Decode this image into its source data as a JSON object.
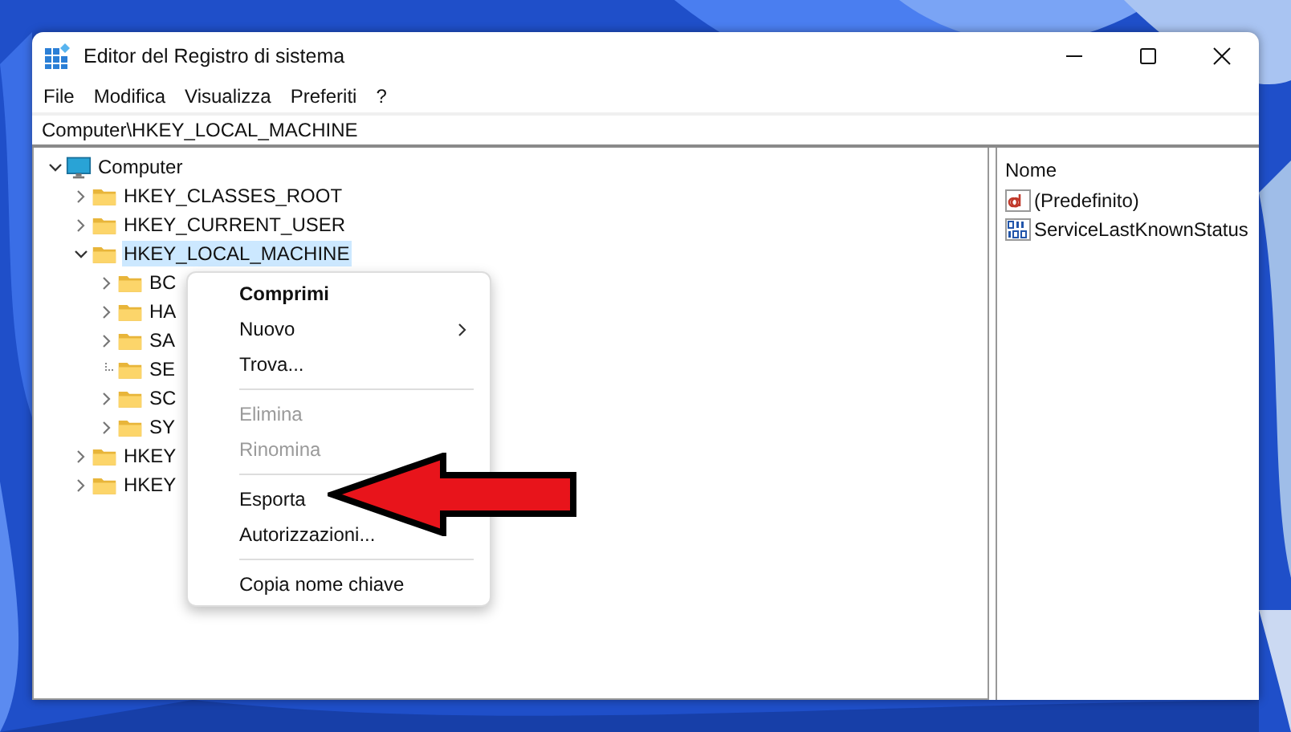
{
  "window": {
    "title": "Editor del Registro di sistema"
  },
  "menu_bar": [
    "File",
    "Modifica",
    "Visualizza",
    "Preferiti",
    "?"
  ],
  "address_bar": {
    "value": "Computer\\HKEY_LOCAL_MACHINE"
  },
  "tree": [
    {
      "label": "Computer",
      "kind": "computer",
      "expandable": true,
      "expanded": true,
      "selected": false,
      "children": [
        {
          "label": "HKEY_CLASSES_ROOT",
          "kind": "folder",
          "expandable": true,
          "expanded": false,
          "selected": false
        },
        {
          "label": "HKEY_CURRENT_USER",
          "kind": "folder",
          "expandable": true,
          "expanded": false,
          "selected": false
        },
        {
          "label": "HKEY_LOCAL_MACHINE",
          "kind": "folder",
          "expandable": true,
          "expanded": true,
          "selected": true,
          "children": [
            {
              "label": "BC",
              "kind": "folder",
              "expandable": true,
              "expanded": false,
              "selected": false
            },
            {
              "label": "HA",
              "kind": "folder",
              "expandable": true,
              "expanded": false,
              "selected": false
            },
            {
              "label": "SA",
              "kind": "folder",
              "expandable": true,
              "expanded": false,
              "selected": false
            },
            {
              "label": "SE",
              "kind": "folder",
              "expandable": false,
              "selected": false
            },
            {
              "label": "SC",
              "kind": "folder",
              "expandable": true,
              "expanded": false,
              "selected": false
            },
            {
              "label": "SY",
              "kind": "folder",
              "expandable": true,
              "expanded": false,
              "selected": false
            }
          ]
        },
        {
          "label": "HKEY",
          "kind": "folder",
          "expandable": true,
          "expanded": false,
          "selected": false
        },
        {
          "label": "HKEY",
          "kind": "folder",
          "expandable": true,
          "expanded": false,
          "selected": false
        }
      ]
    }
  ],
  "values_pane": {
    "columns": [
      "Nome"
    ],
    "rows": [
      {
        "name": "(Predefinito)",
        "kind": "string"
      },
      {
        "name": "ServiceLastKnownStatus",
        "kind": "binary"
      }
    ]
  },
  "context_menu": {
    "groups": [
      [
        {
          "label": "Comprimi",
          "default": true,
          "disabled": false,
          "submenu": false
        },
        {
          "label": "Nuovo",
          "default": false,
          "disabled": false,
          "submenu": true
        },
        {
          "label": "Trova...",
          "default": false,
          "disabled": false,
          "submenu": false
        }
      ],
      [
        {
          "label": "Elimina",
          "default": false,
          "disabled": true,
          "submenu": false
        },
        {
          "label": "Rinomina",
          "default": false,
          "disabled": true,
          "submenu": false
        }
      ],
      [
        {
          "label": "Esporta",
          "default": false,
          "disabled": false,
          "submenu": false
        },
        {
          "label": "Autorizzazioni...",
          "default": false,
          "disabled": false,
          "submenu": false
        }
      ],
      [
        {
          "label": "Copia nome chiave",
          "default": false,
          "disabled": false,
          "submenu": false
        }
      ]
    ]
  }
}
